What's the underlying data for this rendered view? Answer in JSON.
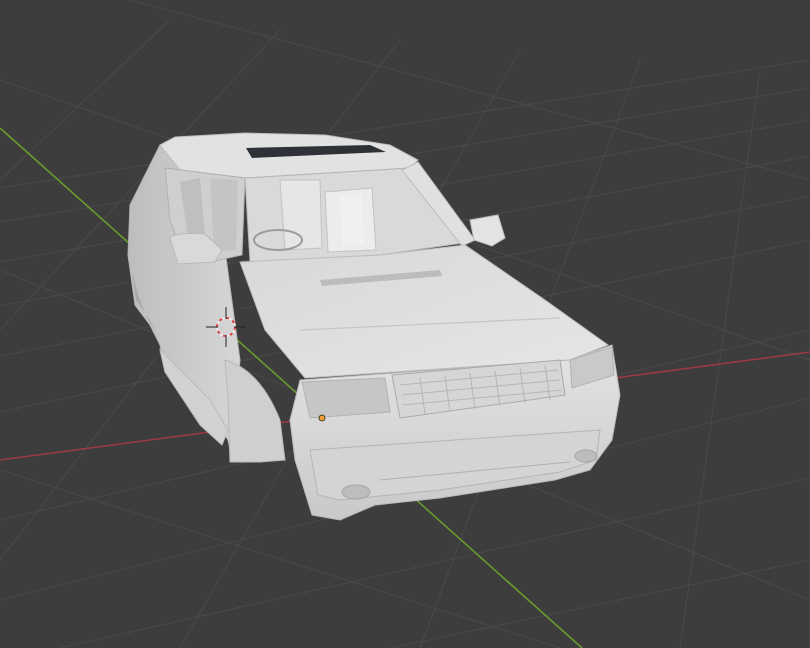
{
  "viewport": {
    "background": "#3d3d3d",
    "grid_color": "#4a4a4a",
    "x_axis_color": "#9a3a44",
    "y_axis_color": "#6b9a2e"
  },
  "scene": {
    "object": "car-body-mesh",
    "origin_color": "#f0a030",
    "cursor_icon": "3d-cursor-icon"
  }
}
